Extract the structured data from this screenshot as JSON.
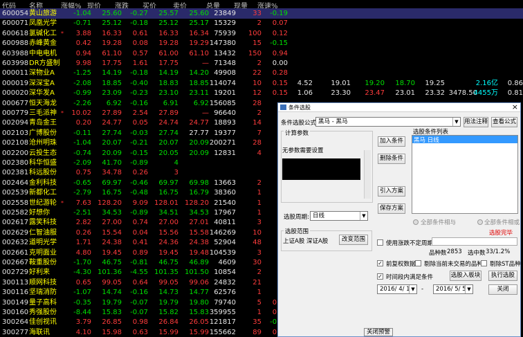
{
  "headers": [
    "代码",
    "名称",
    "涨幅%",
    "现价",
    "涨跌",
    "买价",
    "卖价",
    "总量",
    "现量",
    "涨速%"
  ],
  "rows": [
    {
      "code": "600054",
      "name": "黄山旅游",
      "star": "",
      "pct": "-1.04",
      "price": "25.60",
      "chg": "-0.27",
      "bid": "25.57",
      "ask": "25.60",
      "vol": "23849",
      "cur": "33",
      "spd": "-0.19",
      "cls": "g",
      "sel": true
    },
    {
      "code": "600071",
      "name": "凤凰光学",
      "star": "",
      "pct": "-0.71",
      "price": "25.12",
      "chg": "-0.18",
      "bid": "25.12",
      "ask": "25.17",
      "vol": "15329",
      "cur": "2",
      "spd": "0.07",
      "cls": "g"
    },
    {
      "code": "600618",
      "name": "氯碱化工",
      "star": "*",
      "pct": "3.88",
      "price": "16.33",
      "chg": "0.61",
      "bid": "16.33",
      "ask": "16.34",
      "vol": "75939",
      "cur": "100",
      "spd": "0.12",
      "cls": "r"
    },
    {
      "code": "600988",
      "name": "赤峰黄金",
      "star": "",
      "pct": "0.42",
      "price": "19.28",
      "chg": "0.08",
      "bid": "19.28",
      "ask": "19.29",
      "vol": "147380",
      "cur": "15",
      "spd": "-0.15",
      "cls": "r"
    },
    {
      "code": "603988",
      "name": "中电电机",
      "star": "",
      "pct": "0.94",
      "price": "61.10",
      "chg": "0.57",
      "bid": "61.00",
      "ask": "61.10",
      "vol": "13432",
      "cur": "150",
      "spd": "0.94",
      "cls": "r"
    },
    {
      "code": "603998",
      "name": "DR方盛制",
      "star": "",
      "pct": "9.98",
      "price": "17.75",
      "chg": "1.61",
      "bid": "17.75",
      "ask": "—",
      "vol": "71348",
      "cur": "2",
      "spd": "0.00",
      "cls": "r"
    },
    {
      "code": "000011",
      "name": "深物业A",
      "star": "",
      "pct": "-1.25",
      "price": "14.19",
      "chg": "-0.18",
      "bid": "14.19",
      "ask": "14.20",
      "vol": "49908",
      "cur": "22",
      "spd": "0.28",
      "cls": "g"
    },
    {
      "code": "000019",
      "name": "深深宝A",
      "star": "",
      "pct": "-2.08",
      "price": "18.85",
      "chg": "-0.40",
      "bid": "18.83",
      "ask": "18.85",
      "vol": "114074",
      "cur": "10",
      "spd": "0.15",
      "cls": "g"
    },
    {
      "code": "000020",
      "name": "深华发A",
      "star": "",
      "pct": "-0.99",
      "price": "23.09",
      "chg": "-0.23",
      "bid": "23.10",
      "ask": "23.11",
      "vol": "19201",
      "cur": "12",
      "spd": "0.15",
      "cls": "g"
    },
    {
      "code": "000677",
      "name": "恒天海龙",
      "star": "",
      "pct": "-2.26",
      "price": "6.92",
      "chg": "-0.16",
      "bid": "6.91",
      "ask": "6.92",
      "vol": "156085",
      "cur": "28",
      "spd": "",
      "cls": "g"
    },
    {
      "code": "000779",
      "name": "三毛派神",
      "star": "*",
      "pct": "10.02",
      "price": "27.89",
      "chg": "2.54",
      "bid": "27.89",
      "ask": "—",
      "vol": "96640",
      "cur": "2",
      "spd": "",
      "cls": "r"
    },
    {
      "code": "002094",
      "name": "青岛金王",
      "star": "",
      "pct": "0.20",
      "price": "24.77",
      "chg": "0.05",
      "bid": "24.74",
      "ask": "24.77",
      "vol": "18893",
      "cur": "14",
      "spd": "",
      "cls": "r"
    },
    {
      "code": "002103",
      "name": "广博股份",
      "star": "",
      "pct": "-0.11",
      "price": "27.74",
      "chg": "-0.03",
      "bid": "27.74",
      "ask": "27.77",
      "vol": "19377",
      "cur": "7",
      "spd": "",
      "cls": "g"
    },
    {
      "code": "002108",
      "name": "沧州明珠",
      "star": "",
      "pct": "-1.04",
      "price": "20.07",
      "chg": "-0.21",
      "bid": "20.07",
      "ask": "20.09",
      "vol": "200271",
      "cur": "28",
      "spd": "",
      "cls": "g"
    },
    {
      "code": "002200",
      "name": "云投生态",
      "star": "",
      "pct": "-0.74",
      "price": "20.09",
      "chg": "-0.15",
      "bid": "20.05",
      "ask": "20.09",
      "vol": "12831",
      "cur": "4",
      "spd": "",
      "cls": "g"
    },
    {
      "code": "002380",
      "name": "科华恒盛",
      "star": "",
      "pct": "-2.09",
      "price": "41.70",
      "chg": "-0.89",
      "bid": "4",
      "ask": "",
      "vol": "",
      "cur": "",
      "spd": "",
      "cls": "g"
    },
    {
      "code": "002381",
      "name": "科远股份",
      "star": "",
      "pct": "0.75",
      "price": "34.78",
      "chg": "0.26",
      "bid": "3",
      "ask": "",
      "vol": "",
      "cur": "",
      "spd": "",
      "cls": "r"
    },
    {
      "code": "002464",
      "name": "金利科技",
      "star": "",
      "pct": "-0.65",
      "price": "69.97",
      "chg": "-0.46",
      "bid": "69.97",
      "ask": "69.98",
      "vol": "13663",
      "cur": "2",
      "spd": "",
      "cls": "g"
    },
    {
      "code": "002539",
      "name": "新都化工",
      "star": "",
      "pct": "-2.79",
      "price": "16.75",
      "chg": "-0.48",
      "bid": "16.75",
      "ask": "16.79",
      "vol": "38360",
      "cur": "1",
      "spd": "",
      "cls": "g"
    },
    {
      "code": "002558",
      "name": "世纪游轮",
      "star": "*",
      "pct": "7.63",
      "price": "128.20",
      "chg": "9.09",
      "bid": "128.01",
      "ask": "128.20",
      "vol": "21540",
      "cur": "1",
      "spd": "",
      "cls": "r"
    },
    {
      "code": "002582",
      "name": "好想你",
      "star": "",
      "pct": "-2.51",
      "price": "34.53",
      "chg": "-0.89",
      "bid": "34.51",
      "ask": "34.53",
      "vol": "17967",
      "cur": "1",
      "spd": "",
      "cls": "g"
    },
    {
      "code": "002617",
      "name": "露笑科技",
      "star": "",
      "pct": "2.82",
      "price": "27.00",
      "chg": "0.74",
      "bid": "27.00",
      "ask": "27.01",
      "vol": "40811",
      "cur": "3",
      "spd": "",
      "cls": "r"
    },
    {
      "code": "002629",
      "name": "仁智油服",
      "star": "",
      "pct": "0.26",
      "price": "15.54",
      "chg": "0.04",
      "bid": "15.56",
      "ask": "15.58",
      "vol": "146269",
      "cur": "10",
      "spd": "",
      "cls": "r"
    },
    {
      "code": "002632",
      "name": "道明光学",
      "star": "",
      "pct": "1.71",
      "price": "24.38",
      "chg": "0.41",
      "bid": "24.36",
      "ask": "24.38",
      "vol": "52904",
      "cur": "48",
      "spd": "",
      "cls": "r"
    },
    {
      "code": "002661",
      "name": "克明面业",
      "star": "",
      "pct": "4.80",
      "price": "19.45",
      "chg": "0.89",
      "bid": "19.45",
      "ask": "19.48",
      "vol": "104539",
      "cur": "3",
      "spd": "",
      "cls": "r"
    },
    {
      "code": "002667",
      "name": "鞍重股份",
      "star": "",
      "pct": "-1.70",
      "price": "46.75",
      "chg": "-0.81",
      "bid": "46.75",
      "ask": "46.89",
      "vol": "4609",
      "cur": "30",
      "spd": "",
      "cls": "g"
    },
    {
      "code": "002729",
      "name": "好利来",
      "star": "",
      "pct": "-4.30",
      "price": "101.36",
      "chg": "-4.55",
      "bid": "101.35",
      "ask": "101.50",
      "vol": "10854",
      "cur": "2",
      "spd": "",
      "cls": "g"
    },
    {
      "code": "300113",
      "name": "顺网科技",
      "star": "",
      "pct": "0.65",
      "price": "99.05",
      "chg": "0.64",
      "bid": "99.05",
      "ask": "99.06",
      "vol": "24832",
      "cur": "21",
      "spd": "",
      "cls": "r"
    },
    {
      "code": "300116",
      "name": "坚瑞消防",
      "star": "",
      "pct": "-1.07",
      "price": "14.74",
      "chg": "-0.16",
      "bid": "14.73",
      "ask": "14.77",
      "vol": "62576",
      "cur": "1",
      "spd": "",
      "cls": "g"
    },
    {
      "code": "300149",
      "name": "量子高科",
      "star": "",
      "pct": "-0.35",
      "price": "19.79",
      "chg": "-0.07",
      "bid": "19.79",
      "ask": "19.80",
      "vol": "79740",
      "cur": "5",
      "spd": "0.20",
      "cls": "g"
    },
    {
      "code": "300160",
      "name": "秀强股份",
      "star": "",
      "pct": "-8.44",
      "price": "15.83",
      "chg": "-0.07",
      "bid": "15.82",
      "ask": "15.83",
      "vol": "359955",
      "cur": "1",
      "spd": "0.57",
      "cls": "g"
    },
    {
      "code": "300264",
      "name": "佳创视讯",
      "star": "",
      "pct": "3.79",
      "price": "26.85",
      "chg": "0.98",
      "bid": "26.84",
      "ask": "26.05",
      "vol": "121817",
      "cur": "35",
      "spd": "-0.44",
      "cls": "r"
    },
    {
      "code": "300277",
      "name": "海联讯",
      "star": "",
      "pct": "4.10",
      "price": "15.98",
      "chg": "0.63",
      "bid": "15.99",
      "ask": "15.99",
      "vol": "155662",
      "cur": "89",
      "spd": "0.61",
      "cls": "r"
    }
  ],
  "extra": [
    {
      "row": 7,
      "cells": [
        "4.52",
        "19.01",
        "19.20",
        "18.70",
        "19.25",
        "",
        "2.16亿",
        "0.86"
      ]
    },
    {
      "row": 8,
      "cells": [
        "1.06",
        "23.30",
        "23.47",
        "23.01",
        "23.32",
        "3478.50",
        "4455万",
        "0.81"
      ]
    },
    {
      "row": 29,
      "cells": [
        "1.89",
        "19.86"
      ]
    },
    {
      "row": 30,
      "cells": [
        "6.11",
        "15.30"
      ]
    },
    {
      "row": 31,
      "cells": [
        "7.19",
        "25.90"
      ]
    },
    {
      "row": 32,
      "cells": [
        "7.03",
        "15.40"
      ]
    }
  ],
  "dialog": {
    "title": "条件选股",
    "formula_label": "条件选股公式",
    "formula_value": "黑马 - 黑马",
    "btn_usage": "用法注释",
    "btn_view": "查看公式",
    "params_label": "计算参数",
    "params_text": "无参数需要设置",
    "btn_add": "加入条件",
    "btn_del": "删除条件",
    "btn_import": "引入方案",
    "btn_save": "保存方案",
    "list_label": "选股条件列表",
    "list_item": "黑马  日线",
    "period_label": "选股周期:",
    "period_value": "日线",
    "radio_and": "全部条件相与",
    "radio_or": "全部条件相或",
    "done_text": "选股完毕",
    "range_label": "选股范围",
    "range_text": "上证A股 深证A股",
    "btn_range": "改变范围",
    "chk_custom": "使用涨跌不定周期",
    "count_label": "品种数",
    "count_value": "2853",
    "selected_label": "选中数",
    "selected_value": "33/1.2%",
    "chk_prefix": "前复权数据",
    "chk_nontrade": "剔除当前未交易的品种",
    "chk_st": "剔除ST品种",
    "chk_range": "时间段内满足条件",
    "btn_board": "选股入板块",
    "btn_run": "执行选股",
    "date_from": "2016/ 4/ 1",
    "date_to": "2016/ 5/ 5",
    "btn_close": "关闭"
  },
  "close_tip": "关闭预警",
  "watermark": "www.7gpzb.com"
}
